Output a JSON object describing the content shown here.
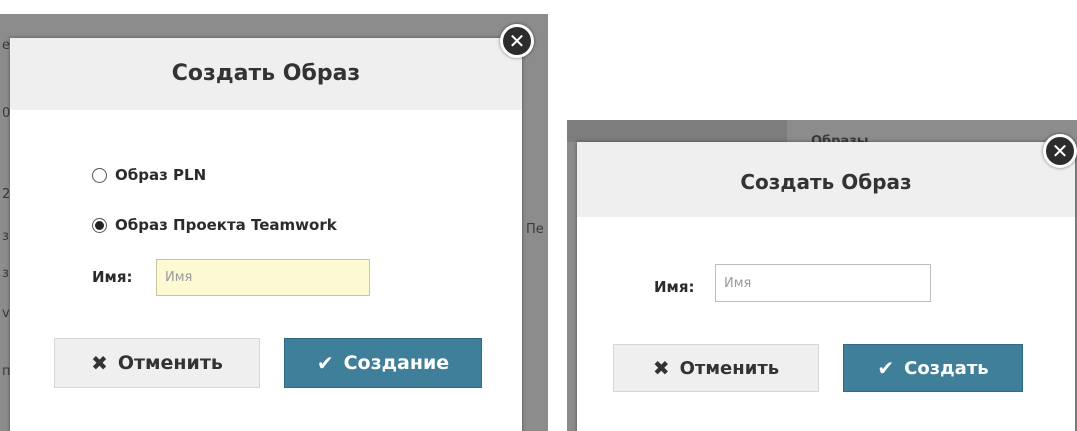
{
  "left_dialog": {
    "title": "Создать Образ",
    "close_icon": "close-icon",
    "radio_options": [
      {
        "label": "Образ PLN",
        "checked": false
      },
      {
        "label": "Образ Проекта Teamwork",
        "checked": true
      }
    ],
    "name_label": "Имя:",
    "name_placeholder": "Имя",
    "cancel_label": "Отменить",
    "confirm_label": "Создание",
    "cancel_icon": "x-icon",
    "confirm_icon": "checkmark-icon"
  },
  "right_dialog": {
    "title": "Создать Образ",
    "close_icon": "close-icon",
    "background_header": "Образы",
    "name_label": "Имя:",
    "name_placeholder": "Имя",
    "cancel_label": "Отменить",
    "confirm_label": "Создать",
    "cancel_icon": "x-icon",
    "confirm_icon": "checkmark-icon"
  },
  "background_fragments": {
    "left_edge": [
      "е",
      "0",
      "2",
      "з",
      "з",
      "v",
      "п"
    ],
    "left_right_fragment": "Пе"
  },
  "colors": {
    "overlay": "#8c8c8c",
    "header": "#efefef",
    "primary": "#3f7f99",
    "input_highlight": "#fdfad3"
  }
}
